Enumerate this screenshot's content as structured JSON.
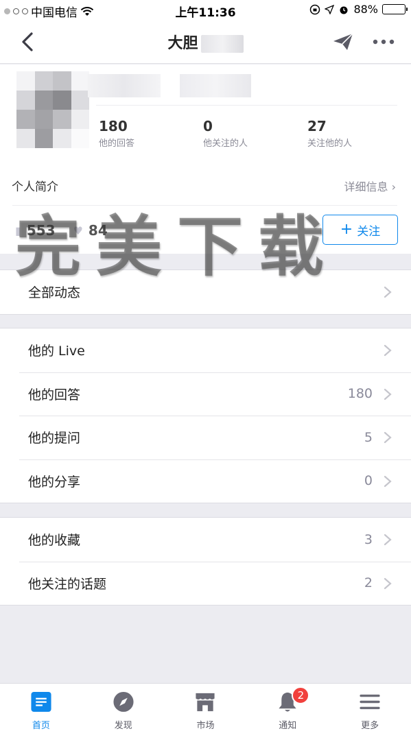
{
  "status_bar": {
    "carrier": "中国电信",
    "time": "上午11:36",
    "battery": "88%",
    "battery_level": 0.88
  },
  "nav": {
    "title": "大胆",
    "back_icon": "chevron-left-icon",
    "send_icon": "paper-plane-icon",
    "more_icon": "more-dots-icon"
  },
  "profile": {
    "stats": [
      {
        "num": "180",
        "label": "他的回答"
      },
      {
        "num": "0",
        "label": "他关注的人"
      },
      {
        "num": "27",
        "label": "关注他的人"
      }
    ],
    "intro_label": "个人简介",
    "intro_detail": "详细信息 ›",
    "agree_count": "553",
    "thanks_count": "84",
    "follow_label": "关注",
    "follow_plus": "+"
  },
  "watermark": "完美下载",
  "groups": [
    {
      "rows": [
        {
          "label": "全部动态",
          "count": ""
        }
      ]
    },
    {
      "rows": [
        {
          "label": "他的 Live",
          "count": ""
        },
        {
          "label": "他的回答",
          "count": "180"
        },
        {
          "label": "他的提问",
          "count": "5"
        },
        {
          "label": "他的分享",
          "count": "0"
        }
      ]
    },
    {
      "rows": [
        {
          "label": "他的收藏",
          "count": "3"
        },
        {
          "label": "他关注的话题",
          "count": "2"
        }
      ]
    }
  ],
  "tabs": [
    {
      "label": "首页",
      "icon": "home-icon",
      "active": true
    },
    {
      "label": "发现",
      "icon": "compass-icon",
      "active": false
    },
    {
      "label": "市场",
      "icon": "store-icon",
      "active": false
    },
    {
      "label": "通知",
      "icon": "bell-icon",
      "active": false,
      "badge": "2"
    },
    {
      "label": "更多",
      "icon": "menu-icon",
      "active": false
    }
  ],
  "colors": {
    "accent": "#0f88eb",
    "badge": "#f1403c",
    "background": "#ececf1"
  }
}
